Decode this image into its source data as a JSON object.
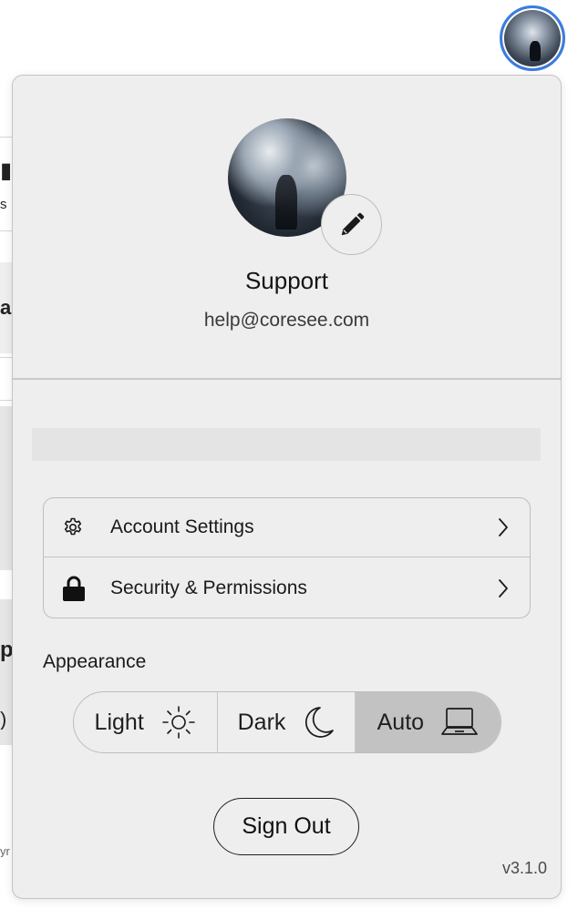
{
  "background": {
    "fragments": [
      "",
      "s",
      "ar",
      "p",
      ")",
      "yr"
    ]
  },
  "header": {
    "avatar_alt": "User avatar",
    "avatar_accent": "#3b7de0"
  },
  "profile": {
    "name": "Support",
    "email": "help@coresee.com",
    "edit_icon": "pencil-icon"
  },
  "menu": {
    "items": [
      {
        "label": "Account Settings",
        "icon": "gear-icon"
      },
      {
        "label": "Security & Permissions",
        "icon": "lock-icon"
      }
    ]
  },
  "appearance": {
    "label": "Appearance",
    "options": [
      {
        "label": "Light",
        "icon": "sun-icon"
      },
      {
        "label": "Dark",
        "icon": "moon-icon"
      },
      {
        "label": "Auto",
        "icon": "laptop-icon"
      }
    ],
    "selected": "Auto"
  },
  "actions": {
    "sign_out": "Sign Out"
  },
  "footer": {
    "version": "v3.1.0"
  }
}
